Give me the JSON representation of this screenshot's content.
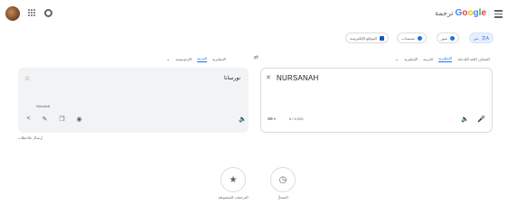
{
  "header": {
    "brand_name": "Google",
    "brand_sub": "ترجمة"
  },
  "mode_tabs": [
    {
      "label": "نص"
    },
    {
      "label": "صور"
    },
    {
      "label": "مستندات"
    },
    {
      "label": "المواقع الإلكترونية"
    }
  ],
  "source_langs": {
    "items": [
      "اكتشاف اللغة المُدخلة",
      "الإنجليزية",
      "العربية",
      "الإنجليزية"
    ]
  },
  "target_langs": {
    "items": [
      "العربية",
      "الإنجليزية",
      "الإندونيسية"
    ]
  },
  "source": {
    "text": "NURSANAH",
    "counter": "8 / 5,000"
  },
  "target": {
    "text": "نورسانا",
    "transliteration": "Nūrsānā"
  },
  "feedback": "إرسال ملاحظات",
  "bottom_actions": [
    {
      "label": "السجلّ",
      "icon": "history-icon"
    },
    {
      "label": "الترجمات المحفوظة",
      "icon": "star-icon"
    }
  ],
  "colors": {
    "accent": "#1a73e8",
    "panel_bg": "#f1f3f4"
  }
}
